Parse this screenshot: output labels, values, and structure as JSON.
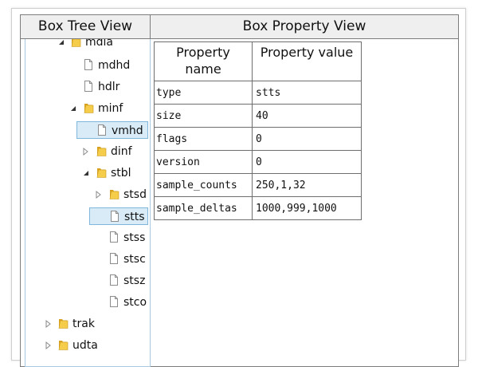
{
  "headers": {
    "tree": "Box Tree View",
    "properties": "Box Property View"
  },
  "tree": [
    {
      "label": "mdia",
      "kind": "folder",
      "state": "expanded"
    },
    {
      "label": "mdhd",
      "kind": "file"
    },
    {
      "label": "hdlr",
      "kind": "file"
    },
    {
      "label": "minf",
      "kind": "folder",
      "state": "expanded"
    },
    {
      "label": "vmhd",
      "kind": "file",
      "selected": true
    },
    {
      "label": "dinf",
      "kind": "folder",
      "state": "collapsed"
    },
    {
      "label": "stbl",
      "kind": "folder",
      "state": "expanded"
    },
    {
      "label": "stsd",
      "kind": "folder",
      "state": "collapsed"
    },
    {
      "label": "stts",
      "kind": "file",
      "selected": true
    },
    {
      "label": "stss",
      "kind": "file"
    },
    {
      "label": "stsc",
      "kind": "file"
    },
    {
      "label": "stsz",
      "kind": "file"
    },
    {
      "label": "stco",
      "kind": "file"
    },
    {
      "label": "trak",
      "kind": "folder",
      "state": "collapsed"
    },
    {
      "label": "udta",
      "kind": "folder",
      "state": "collapsed"
    }
  ],
  "props": {
    "col_name": "Property name",
    "col_value": "Property value",
    "rows": [
      {
        "name": "type",
        "value": "stts"
      },
      {
        "name": "size",
        "value": "40"
      },
      {
        "name": "flags",
        "value": "0"
      },
      {
        "name": "version",
        "value": "0"
      },
      {
        "name": "sample_counts",
        "value": "250,1,32"
      },
      {
        "name": "sample_deltas",
        "value": "1000,999,1000"
      }
    ]
  },
  "colors": {
    "selection": "#d8ebf7",
    "selection_border": "#7fb6db",
    "folder": "#f0c23b",
    "header_bg": "#efefef"
  },
  "icons": {
    "folder": "folder-icon",
    "file": "file-icon",
    "expanded": "expanded-triangle-icon",
    "collapsed": "collapsed-triangle-icon"
  }
}
